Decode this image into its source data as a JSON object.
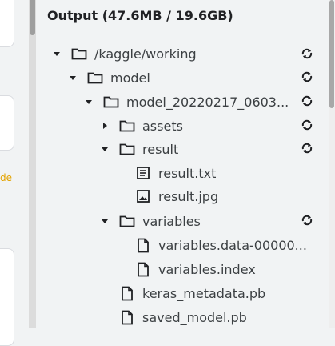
{
  "left_strip": {
    "cut_text": "de"
  },
  "output_panel": {
    "title": "Output (47.6MB / 19.6GB)",
    "tree": [
      {
        "label": "/kaggle/working",
        "type": "folder",
        "caret": "down",
        "sync": true
      },
      {
        "label": "model",
        "type": "folder",
        "caret": "down",
        "sync": true
      },
      {
        "label": "model_20220217_0603...",
        "type": "folder",
        "caret": "down",
        "sync": true
      },
      {
        "label": "assets",
        "type": "folder",
        "caret": "right",
        "sync": true
      },
      {
        "label": "result",
        "type": "folder",
        "caret": "down",
        "sync": true
      },
      {
        "label": "result.txt",
        "type": "text-file",
        "caret": "none",
        "sync": false
      },
      {
        "label": "result.jpg",
        "type": "image-file",
        "caret": "none",
        "sync": false
      },
      {
        "label": "variables",
        "type": "folder",
        "caret": "down",
        "sync": true
      },
      {
        "label": "variables.data-00000...",
        "type": "file",
        "caret": "none",
        "sync": false
      },
      {
        "label": "variables.index",
        "type": "file",
        "caret": "none",
        "sync": false
      },
      {
        "label": "keras_metadata.pb",
        "type": "file",
        "caret": "none",
        "sync": false
      },
      {
        "label": "saved_model.pb",
        "type": "file",
        "caret": "none",
        "sync": false
      }
    ]
  },
  "colors": {
    "accent_text": "#e3a300",
    "panel_bg": "#f1f3f4",
    "text": "#3c4043"
  }
}
